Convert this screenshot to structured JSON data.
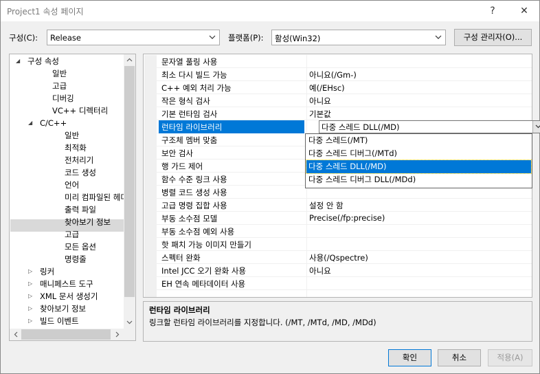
{
  "window": {
    "title": "Project1 속성 페이지",
    "help_glyph": "?",
    "close_glyph": "✕"
  },
  "config": {
    "config_label": "구성(C):",
    "config_value": "Release",
    "platform_label": "플랫폼(P):",
    "platform_value": "활성(Win32)",
    "manager_button": "구성 관리자(O)..."
  },
  "tree": {
    "items": [
      {
        "label": "구성 속성",
        "expander": "◢"
      },
      {
        "label": "일반"
      },
      {
        "label": "고급"
      },
      {
        "label": "디버깅"
      },
      {
        "label": "VC++ 디렉터리"
      },
      {
        "label": "C/C++",
        "expander": "◢"
      },
      {
        "label": "일반"
      },
      {
        "label": "최적화"
      },
      {
        "label": "전처리기"
      },
      {
        "label": "코드 생성"
      },
      {
        "label": "언어"
      },
      {
        "label": "미리 컴파일된 헤더"
      },
      {
        "label": "출력 파일"
      },
      {
        "label": "찾아보기 정보"
      },
      {
        "label": "고급"
      },
      {
        "label": "모든 옵션"
      },
      {
        "label": "명령줄"
      },
      {
        "label": "링커",
        "expander": "▷"
      },
      {
        "label": "매니페스트 도구",
        "expander": "▷"
      },
      {
        "label": "XML 문서 생성기",
        "expander": "▷"
      },
      {
        "label": "찾아보기 정보",
        "expander": "▷"
      },
      {
        "label": "빌드 이벤트",
        "expander": "▷"
      }
    ]
  },
  "grid": {
    "rows": [
      {
        "name": "문자열 풀링 사용",
        "value": ""
      },
      {
        "name": "최소 다시 빌드 가능",
        "value": "아니요(/Gm-)"
      },
      {
        "name": "C++ 예외 처리 가능",
        "value": "예(/EHsc)"
      },
      {
        "name": "작은 형식 검사",
        "value": "아니요"
      },
      {
        "name": "기본 런타임 검사",
        "value": "기본값"
      },
      {
        "name": "런타임 라이브러리",
        "value": "다중 스레드 DLL(/MD)"
      },
      {
        "name": "구조체 멤버 맞춤",
        "value": ""
      },
      {
        "name": "보안 검사",
        "value": ""
      },
      {
        "name": "행 가드 제어",
        "value": ""
      },
      {
        "name": "함수 수준 링크 사용",
        "value": ""
      },
      {
        "name": "병렬 코드 생성 사용",
        "value": ""
      },
      {
        "name": "고급 명령 집합 사용",
        "value": "설정 안 함"
      },
      {
        "name": "부동 소수점 모델",
        "value": "Precise(/fp:precise)"
      },
      {
        "name": "부동 소수점 예외 사용",
        "value": ""
      },
      {
        "name": "핫 패치 가능 이미지 만들기",
        "value": ""
      },
      {
        "name": "스펙터 완화",
        "value": "사용(/Qspectre)"
      },
      {
        "name": "Intel JCC 오기 완화 사용",
        "value": "아니요"
      },
      {
        "name": "EH 연속 메타데이터 사용",
        "value": ""
      }
    ]
  },
  "dropdown": {
    "options": [
      "다중 스레드(/MT)",
      "다중 스레드 디버그(/MTd)",
      "다중 스레드 DLL(/MD)",
      "다중 스레드 디버그 DLL(/MDd)"
    ],
    "highlighted": "다중 스레드 DLL(/MD)"
  },
  "description": {
    "title": "런타임 라이브러리",
    "body": "링크할 런타임 라이브러리를 지정합니다.     (/MT, /MTd, /MD, /MDd)"
  },
  "buttons": {
    "ok": "확인",
    "cancel": "취소",
    "apply": "적용(A)"
  },
  "icons": [
    "help-icon",
    "close-icon",
    "chevron-down-icon",
    "expand-arrow-icon",
    "collapse-arrow-icon",
    "scroll-up-icon",
    "scroll-down-icon",
    "scroll-left-icon",
    "scroll-right-icon"
  ]
}
